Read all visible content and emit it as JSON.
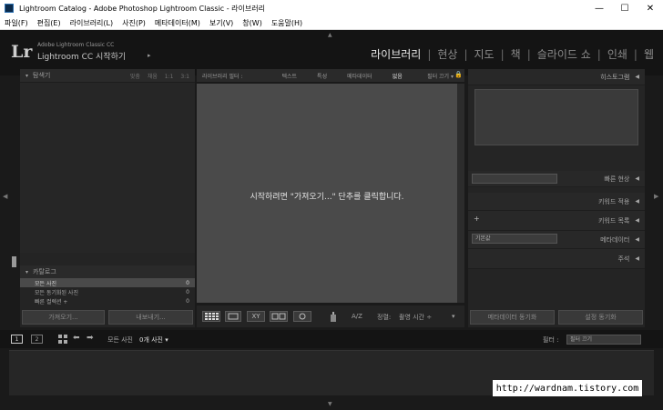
{
  "window": {
    "title": "Lightroom Catalog - Adobe Photoshop Lightroom Classic - 라이브러리",
    "minimize": "—",
    "maximize": "☐",
    "close": "✕"
  },
  "menu": [
    "파일(F)",
    "편집(E)",
    "라이브러리(L)",
    "사진(P)",
    "메타데이터(M)",
    "보기(V)",
    "창(W)",
    "도움말(H)"
  ],
  "identity": {
    "logo": "Lr",
    "line1": "Adobe Lightroom Classic CC",
    "line2": "Lightroom CC 시작하기",
    "arrow": "▸"
  },
  "modules": [
    "라이브러리",
    "현상",
    "지도",
    "책",
    "슬라이드 쇼",
    "인쇄",
    "웹"
  ],
  "active_module": "라이브러리",
  "navigator": {
    "title": "탐색기",
    "zoom": "맞춤 채움 1:1 3:1",
    "toggle": "▾"
  },
  "catalog": {
    "title": "카탈로그",
    "toggle": "▾",
    "rows": [
      {
        "label": "모든 사진",
        "count": "0"
      },
      {
        "label": "모든 동기화된 사진",
        "count": "0"
      },
      {
        "label": "빠른 컬렉션 +",
        "count": "0"
      }
    ]
  },
  "left_buttons": {
    "import": "가져오기...",
    "export": "내보내기..."
  },
  "filter_bar": {
    "label": "라이브러리 필터 :",
    "items": [
      "텍스트",
      "특성",
      "메타데이터",
      "없음"
    ],
    "active": "없음",
    "preset": "필터 끄기 ▾",
    "lock": "🔒"
  },
  "empty_message": "시작하려면 \"가져오기...\" 단추를 클릭합니다.",
  "toolbar": {
    "sort_label": "정렬:",
    "sort_value": "촬영 시간 ÷",
    "az": "A/Z",
    "dropdown": "▾",
    "xy": "XY"
  },
  "right_panel": {
    "histogram": "히스토그램",
    "quick_develop": "빠른 현상",
    "keywording": "키워드 적용",
    "keyword_list": "키워드 목록",
    "metadata": "메타데이터",
    "metadata_preset": "기본값",
    "comments": "주석",
    "plus": "+",
    "toggle": "◀"
  },
  "right_buttons": {
    "sync_meta": "메타데이터 동기화",
    "sync_settings": "설정 동기화"
  },
  "filmstrip": {
    "screen1": "1",
    "screen2": "2",
    "source": "모든 사진",
    "count": "0개 사진 ▾",
    "filter_label": "필터 :",
    "filter_value": "필터 끄기"
  },
  "watermark": "http://wardnam.tistory.com"
}
